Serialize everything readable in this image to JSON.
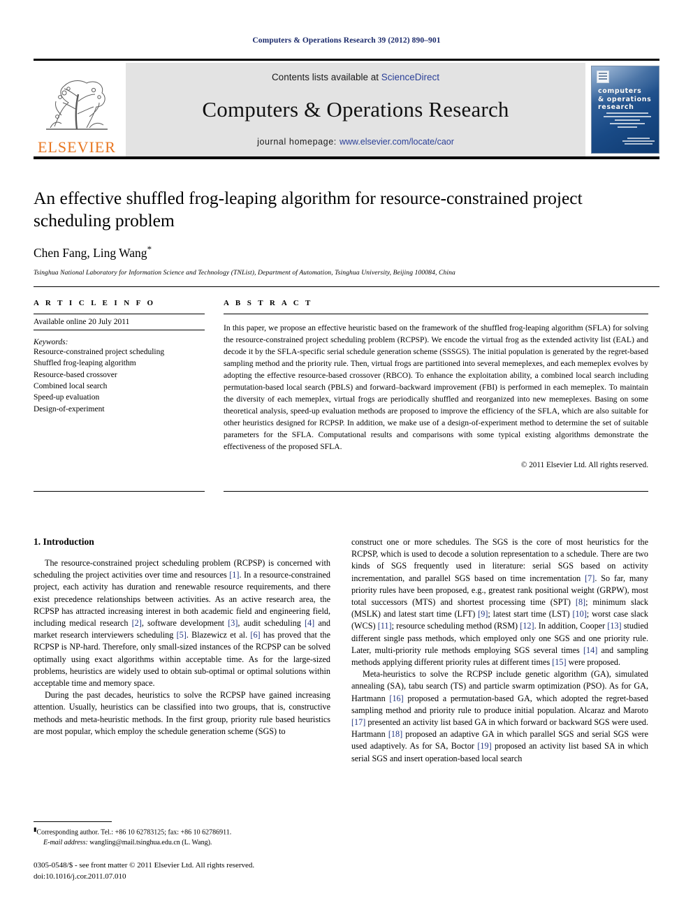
{
  "running_head": "Computers & Operations Research 39 (2012) 890–901",
  "masthead": {
    "publisher_name": "ELSEVIER",
    "contents_prefix": "Contents lists available at ",
    "contents_link": "ScienceDirect",
    "journal_title": "Computers & Operations Research",
    "homepage_prefix": "journal homepage: ",
    "homepage_url": "www.elsevier.com/locate/caor",
    "cover": {
      "title_line1": "computers",
      "title_line2": "& operations",
      "title_line3": "research"
    }
  },
  "article": {
    "title": "An effective shuffled frog-leaping algorithm for resource-constrained project scheduling problem",
    "authors": "Chen Fang, Ling Wang",
    "author_marker": "*",
    "affiliation": "Tsinghua National Laboratory for Information Science and Technology (TNList), Department of Automation, Tsinghua University, Beijing 100084, China"
  },
  "article_info": {
    "heading": "A R T I C L E   I N F O",
    "available_online": "Available online 20 July 2011",
    "keywords_heading": "Keywords:",
    "keywords": [
      "Resource-constrained project scheduling",
      "Shuffled frog-leaping algorithm",
      "Resource-based crossover",
      "Combined local search",
      "Speed-up evaluation",
      "Design-of-experiment"
    ]
  },
  "abstract": {
    "heading": "A B S T R A C T",
    "text": "In this paper, we propose an effective heuristic based on the framework of the shuffled frog-leaping algorithm (SFLA) for solving the resource-constrained project scheduling problem (RCPSP). We encode the virtual frog as the extended activity list (EAL) and decode it by the SFLA-specific serial schedule generation scheme (SSSGS). The initial population is generated by the regret-based sampling method and the priority rule. Then, virtual frogs are partitioned into several memeplexes, and each memeplex evolves by adopting the effective resource-based crossover (RBCO). To enhance the exploitation ability, a combined local search including permutation-based local search (PBLS) and forward–backward improvement (FBI) is performed in each memeplex. To maintain the diversity of each memeplex, virtual frogs are periodically shuffled and reorganized into new memeplexes. Basing on some theoretical analysis, speed-up evaluation methods are proposed to improve the efficiency of the SFLA, which are also suitable for other heuristics designed for RCPSP. In addition, we make use of a design-of-experiment method to determine the set of suitable parameters for the SFLA. Computational results and comparisons with some typical existing algorithms demonstrate the effectiveness of the proposed SFLA.",
    "copyright": "© 2011 Elsevier Ltd. All rights reserved."
  },
  "section": {
    "number_title": "1.  Introduction",
    "paragraphs_left": [
      "The resource-constrained project scheduling problem (RCPSP) is concerned with scheduling the project activities over time and resources [1]. In a resource-constrained project, each activity has duration and renewable resource requirements, and there exist precedence relationships between activities. As an active research area, the RCPSP has attracted increasing interest in both academic field and engineering field, including medical research [2], software development [3], audit scheduling [4] and market research interviewers scheduling [5]. Blazewicz et al. [6] has proved that the RCPSP is NP-hard. Therefore, only small-sized instances of the RCPSP can be solved optimally using exact algorithms within acceptable time. As for the large-sized problems, heuristics are widely used to obtain sub-optimal or optimal solutions within acceptable time and memory space.",
      "During the past decades, heuristics to solve the RCPSP have gained increasing attention. Usually, heuristics can be classified into two groups, that is, constructive methods and meta-heuristic methods. In the first group, priority rule based heuristics are most popular, which employ the schedule generation scheme (SGS) to"
    ],
    "paragraphs_right": [
      "construct one or more schedules. The SGS is the core of most heuristics for the RCPSP, which is used to decode a solution representation to a schedule. There are two kinds of SGS frequently used in literature: serial SGS based on activity incrementation, and parallel SGS based on time incrementation [7]. So far, many priority rules have been proposed, e.g., greatest rank positional weight (GRPW), most total successors (MTS) and shortest processing time (SPT) [8]; minimum slack (MSLK) and latest start time (LFT) [9]; latest start time (LST) [10]; worst case slack (WCS) [11]; resource scheduling method (RSM) [12]. In addition, Cooper [13] studied different single pass methods, which employed only one SGS and one priority rule. Later, multi-priority rule methods employing SGS several times [14] and sampling methods applying different priority rules at different times [15] were proposed.",
      "Meta-heuristics to solve the RCPSP include genetic algorithm (GA), simulated annealing (SA), tabu search (TS) and particle swarm optimization (PSO). As for GA, Hartmann [16] proposed a permutation-based GA, which adopted the regret-based sampling method and priority rule to produce initial population. Alcaraz and Maroto [17] presented an activity list based GA in which forward or backward SGS were used. Hartmann [18] proposed an adaptive GA in which parallel SGS and serial SGS were used adaptively. As for SA, Boctor [19] proposed an activity list based SA in which serial SGS and insert operation-based local search"
    ]
  },
  "footnotes": {
    "corresponding": "Corresponding author. Tel.: +86 10 62783125; fax: +86 10 62786911.",
    "email_label": "E-mail address:",
    "email_value": " wangling@mail.tsinghua.edu.cn (L. Wang).",
    "issn_line": "0305-0548/$ - see front matter © 2011 Elsevier Ltd. All rights reserved.",
    "doi_line": "doi:10.1016/j.cor.2011.07.010"
  },
  "colors": {
    "running_head": "#1b2a6b",
    "link": "#2a3f97",
    "reference": "#22357f",
    "elsevier_orange": "#E87722",
    "band_gray": "#e3e3e3"
  }
}
